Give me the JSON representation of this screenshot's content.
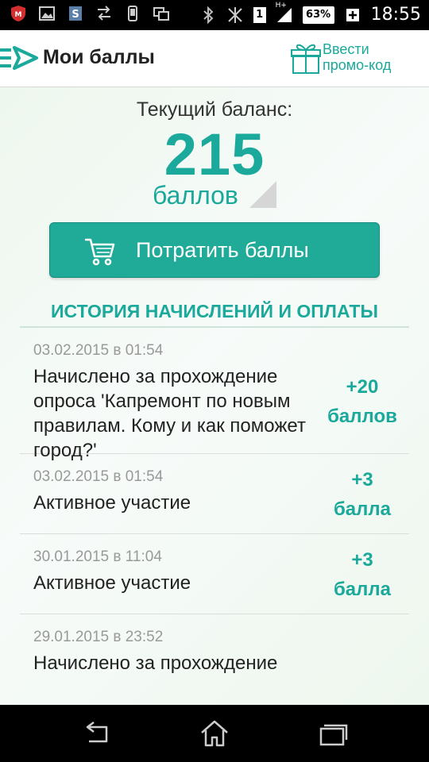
{
  "status_bar": {
    "time": "18:55",
    "battery": "63%",
    "sim_slot": "1",
    "network": "H+",
    "icons": [
      "antivirus-icon",
      "image-icon",
      "s-app-icon",
      "data-transfer-icon",
      "phone-icon",
      "screens-icon",
      "bluetooth-icon",
      "muted-icon",
      "signal-icon",
      "battery-icon"
    ]
  },
  "header": {
    "title": "Мои баллы",
    "promo_label": "Ввести промо-код",
    "icons": [
      "menu-logo-icon",
      "gift-icon"
    ]
  },
  "balance": {
    "caption": "Текущий баланс:",
    "value": "215",
    "unit": "баллов"
  },
  "spend_button": {
    "label": "Потратить баллы",
    "icon": "cart-icon"
  },
  "history": {
    "title": "ИСТОРИЯ НАЧИСЛЕНИЙ И ОПЛАТЫ",
    "items": [
      {
        "date": "03.02.2015 в 01:54",
        "description": "Начислено за прохождение опроса 'Капремонт по новым правилам. Кому и как поможет город?'",
        "points": "+20",
        "points_unit": "баллов"
      },
      {
        "date": "03.02.2015 в 01:54",
        "description": "Активное участие",
        "points": "+3",
        "points_unit": "балла"
      },
      {
        "date": "30.01.2015 в 11:04",
        "description": "Активное участие",
        "points": "+3",
        "points_unit": "балла"
      },
      {
        "date": "29.01.2015 в 23:52",
        "description": "Начислено за прохождение",
        "points": "",
        "points_unit": ""
      }
    ]
  },
  "nav_bar": {
    "icons": [
      "back-icon",
      "home-icon",
      "recents-icon"
    ]
  },
  "colors": {
    "accent": "#1aa99a",
    "button": "#20ab98",
    "background": "#eef7ee"
  }
}
